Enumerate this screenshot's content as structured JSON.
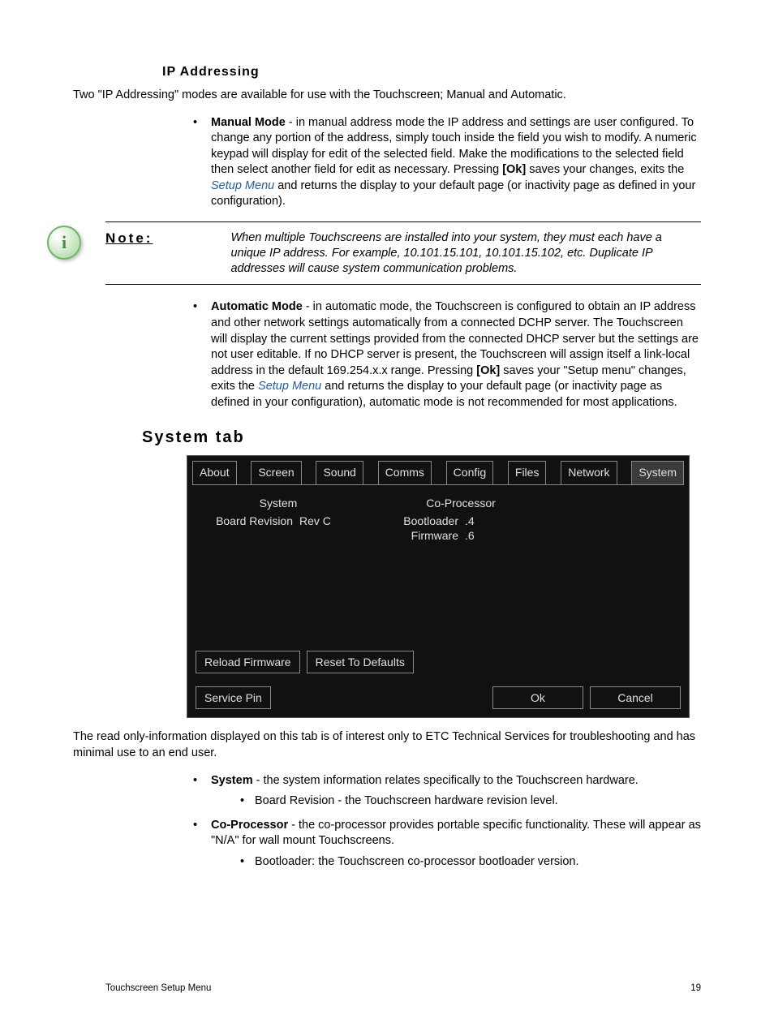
{
  "headings": {
    "ip_addressing": "IP Addressing",
    "system_tab": "System tab"
  },
  "ip_intro": "Two \"IP Addressing\" modes are available for use with the Touchscreen; Manual and Automatic.",
  "manual_mode": {
    "label": "Manual Mode",
    "text1": " - in manual address mode the IP address and settings are user configured. To change any portion of the address, simply touch inside the field you wish to modify. A numeric keypad will display for edit of the selected field. Make the modifications to the selected field then select another field for edit as necessary. Pressing ",
    "ok": "[Ok]",
    "text2": " saves your changes, exits the ",
    "link": "Setup Menu",
    "text3": " and returns the display to your default page (or inactivity page as defined in your configuration)."
  },
  "note": {
    "label": "Note:",
    "text": "When multiple Touchscreens are installed into your system, they must each have a unique IP address. For example, 10.101.15.101, 10.101.15.102, etc. Duplicate IP addresses will cause system communication problems."
  },
  "auto_mode": {
    "label": "Automatic Mode",
    "text1": " - in automatic mode, the Touchscreen is configured to obtain an IP address and other network settings automatically from a connected DCHP server. The Touchscreen will display the current settings provided from the connected DHCP server but the settings are not user editable. If no DHCP server is present, the Touchscreen will assign itself a link-local address in the default 169.254.x.x range. Pressing ",
    "ok": "[Ok]",
    "text2": " saves your \"Setup menu\" changes, exits the ",
    "link": "Setup Menu",
    "text3": " and returns the display to your default page (or inactivity page as defined in your configuration), automatic mode is not recommended for most applications."
  },
  "touchscreen": {
    "tabs": [
      "About",
      "Screen",
      "Sound",
      "Comms",
      "Config",
      "Files",
      "Network",
      "System"
    ],
    "active_tab": "System",
    "system_header": "System",
    "coproc_header": "Co-Processor",
    "board_revision_label": "Board Revision",
    "board_revision_value": "Rev C",
    "bootloader_label": "Bootloader",
    "bootloader_value": ".4",
    "firmware_label": "Firmware",
    "firmware_value": ".6",
    "reload_firmware": "Reload Firmware",
    "reset_defaults": "Reset To Defaults",
    "service_pin": "Service Pin",
    "ok": "Ok",
    "cancel": "Cancel"
  },
  "after_screenshot": "The read only-information displayed on this tab is of interest only to ETC Technical Services for troubleshooting and has minimal use to an end user.",
  "system_bullet": {
    "label": "System",
    "text": " - the system information relates specifically to the Touchscreen hardware.",
    "sub": "Board Revision - the Touchscreen hardware revision level."
  },
  "coproc_bullet": {
    "label": "Co-Processor",
    "text": " - the co-processor provides portable specific functionality. These will appear as \"N/A\" for wall mount Touchscreens.",
    "sub": "Bootloader: the Touchscreen co-processor bootloader version."
  },
  "footer": {
    "left": "Touchscreen Setup Menu",
    "right": "19"
  }
}
